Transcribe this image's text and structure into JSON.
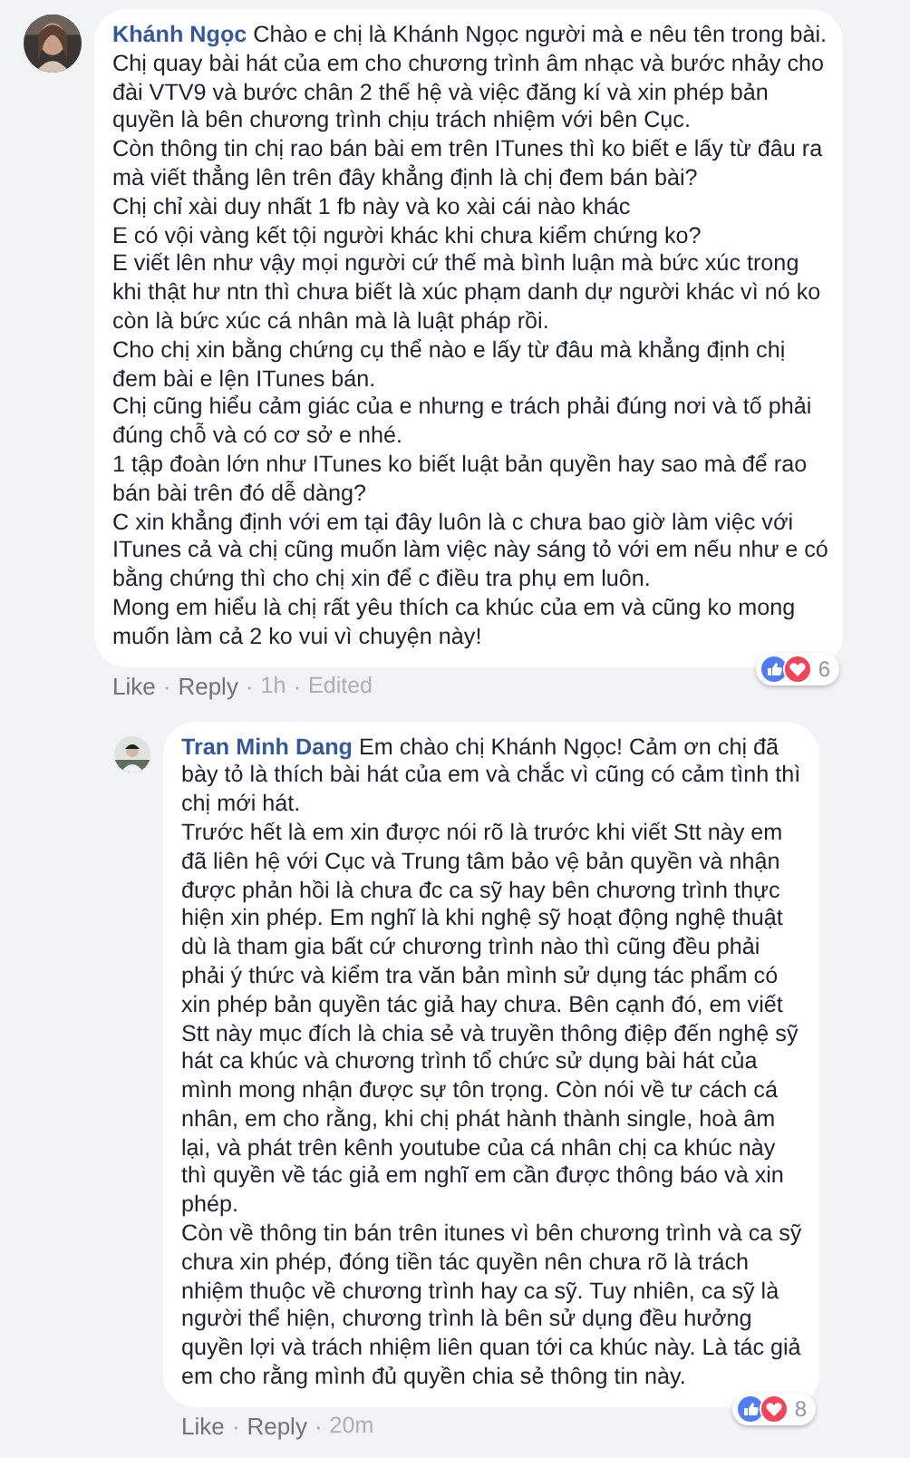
{
  "separator": "·",
  "comments": [
    {
      "author": "Khánh Ngọc",
      "paragraphs": [
        "Chào e chị là Khánh Ngọc người mà e nêu tên trong bài. Chị quay bài hát của em cho chương trình âm nhạc và bước nhảy cho đài VTV9 và bước chân 2 thế hệ và việc đăng kí và xin phép bản quyền là bên chương trình chịu trách nhiệm với bên Cục.",
        "Còn thông tin chị rao bán bài em trên ITunes thì ko biết e lấy từ đâu ra mà viết thẳng lên trên đây khẳng định là chị đem bán bài?",
        "Chị chỉ xài duy nhất 1 fb này và ko xài cái nào khác",
        "E có vội vàng kết tội người khác khi chưa kiểm chứng ko?",
        "E viết lên như vậy mọi người cứ thế mà bình luận mà bức xúc trong khi thật hư ntn thì chưa biết là xúc phạm danh dự người khác vì nó ko còn là bức xúc cá nhân mà là luật pháp rồi.",
        "Cho chị xin bằng chứng cụ thể nào e lấy từ đâu mà khẳng định chị đem bài e lện ITunes bán.",
        "Chị cũng hiểu cảm giác của e nhưng e trách phải đúng nơi và tố phải đúng chỗ và có cơ sở e nhé.",
        "1 tập đoàn lớn như ITunes ko biết luật bản quyền hay sao mà để rao bán bài trên đó dễ dàng?",
        "C xin khẳng định với em tại đây luôn là c chưa bao giờ làm việc với ITunes cả và chị cũng muốn làm việc này sáng tỏ với em nếu như e có bằng chứng thì cho chị xin để c điều tra phụ em luôn.",
        "Mong em hiểu là chị rất yêu thích ca khúc của em và cũng ko mong muốn làm cả 2 ko vui vì chuyện này!"
      ],
      "actions": [
        {
          "label": "Like",
          "kind": "link"
        },
        {
          "label": "Reply",
          "kind": "link"
        },
        {
          "label": "1h",
          "kind": "meta"
        },
        {
          "label": "Edited",
          "kind": "meta"
        }
      ],
      "reaction_count": "6",
      "replies": [
        {
          "author": "Tran Minh Dang",
          "paragraphs": [
            "Em chào chị Khánh Ngọc! Cảm ơn chị đã bày tỏ là thích bài hát của em và chắc vì cũng có cảm tình thì chị mới hát.",
            "Trước hết là em xin được nói rõ là trước khi viết Stt này em đã liên hệ với Cục và Trung tâm bảo vệ bản quyền và nhận được phản hồi là chưa đc ca sỹ hay bên chương trình thực hiện xin phép. Em nghĩ là khi nghệ sỹ hoạt động nghệ thuật dù là tham gia bất cứ chương trình nào thì cũng đều phải phải ý thức và kiểm tra văn bản mình sử dụng tác phẩm có xin phép bản quyền tác giả hay chưa. Bên cạnh đó, em viết Stt này mục đích là chia sẻ và truyền thông điệp đến nghệ sỹ hát ca khúc và chương trình tổ chức sử dụng bài hát của mình mong nhận được sự tôn trọng. Còn nói về tư cách cá nhân, em cho rằng, khi chị phát hành thành single, hoà âm lại, và phát trên kênh youtube của cá nhân chị ca khúc này thì quyền về tác giả em nghĩ em cần được thông báo và xin phép.",
            "Còn về thông tin bán trên itunes vì bên chương trình và ca sỹ chưa xin phép, đóng tiền tác quyền nên chưa rõ là trách nhiệm thuộc về chương trình hay ca sỹ. Tuy nhiên, ca sỹ là người thể hiện, chương trình là bên sử dụng đều hưởng quyền lợi và trách nhiệm liên quan tới ca khúc này. Là tác giả em cho rằng mình đủ quyền chia sẻ thông tin này."
          ],
          "actions": [
            {
              "label": "Like",
              "kind": "link"
            },
            {
              "label": "Reply",
              "kind": "link"
            },
            {
              "label": "20m",
              "kind": "meta"
            }
          ],
          "reaction_count": "8"
        }
      ]
    }
  ]
}
